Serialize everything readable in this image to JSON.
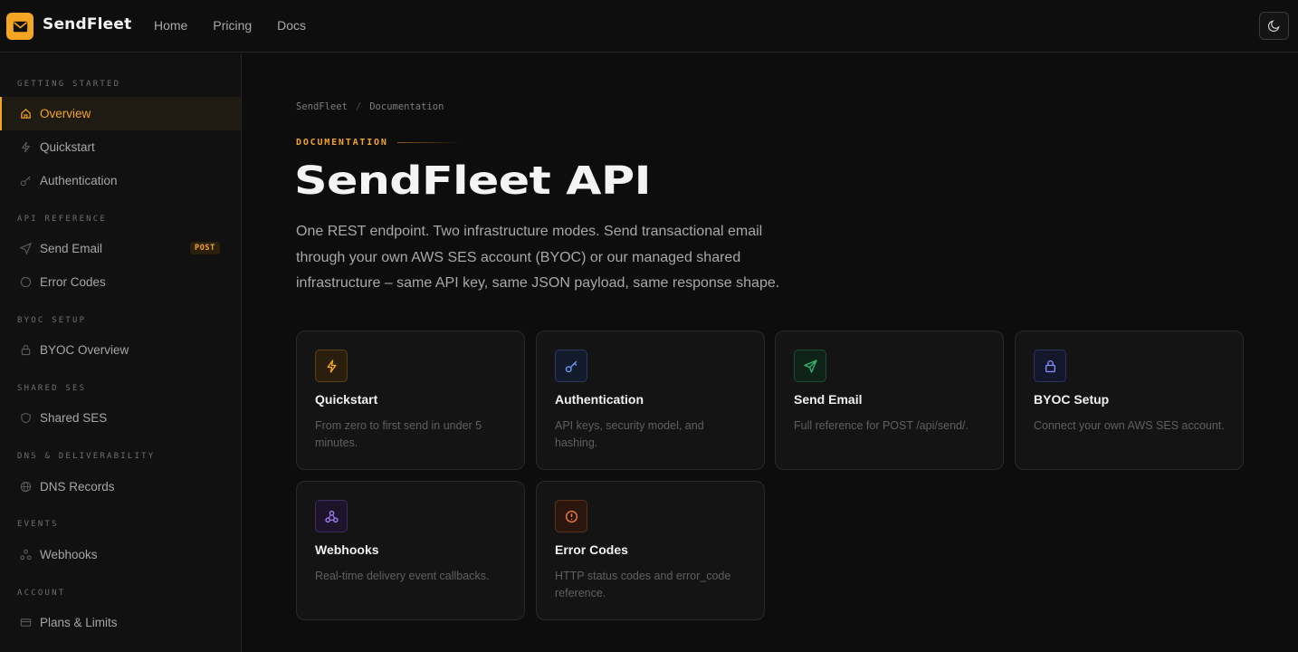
{
  "brand": {
    "name": "SendFleet"
  },
  "topnav": [
    {
      "label": "Home"
    },
    {
      "label": "Pricing"
    },
    {
      "label": "Docs"
    }
  ],
  "colors": {
    "accent": "#f5a524",
    "background": "#0d0d0d",
    "sidebar": "#111111"
  },
  "sidebar": {
    "sections": [
      {
        "title": "GETTING STARTED"
      },
      {
        "title": "API REFERENCE"
      },
      {
        "title": "BYOC SETUP"
      },
      {
        "title": "SHARED SES"
      },
      {
        "title": "DNS & DELIVERABILITY"
      },
      {
        "title": "EVENTS"
      },
      {
        "title": "ACCOUNT"
      }
    ],
    "items": [
      {
        "label": "Overview",
        "icon": "home-icon",
        "active": true
      },
      {
        "label": "Quickstart",
        "icon": "bolt-icon"
      },
      {
        "label": "Authentication",
        "icon": "key-icon"
      },
      {
        "label": "Send Email",
        "icon": "send-icon",
        "badge": "POST"
      },
      {
        "label": "Error Codes",
        "icon": "alert-circle-icon"
      },
      {
        "label": "BYOC Overview",
        "icon": "lock-icon"
      },
      {
        "label": "Shared SES",
        "icon": "shield-icon"
      },
      {
        "label": "DNS Records",
        "icon": "globe-icon"
      },
      {
        "label": "Webhooks",
        "icon": "webhook-icon"
      },
      {
        "label": "Plans & Limits",
        "icon": "card-icon"
      }
    ]
  },
  "breadcrumb": {
    "root": "SendFleet",
    "separator": "/",
    "current": "Documentation"
  },
  "eyebrow": "DOCUMENTATION",
  "title": "SendFleet API",
  "lede": "One REST endpoint. Two infrastructure modes. Send transactional email through your own AWS SES account (BYOC) or our managed shared infrastructure – same API key, same JSON payload, same response shape.",
  "cards": [
    {
      "title": "Quickstart",
      "desc": "From zero to first send in under 5 minutes.",
      "icon": "bolt-icon",
      "color": "#f5a524"
    },
    {
      "title": "Authentication",
      "desc": "API keys, security model, and hashing.",
      "icon": "key-icon",
      "color": "#5b8def"
    },
    {
      "title": "Send Email",
      "desc": "Full reference for POST /api/send/.",
      "icon": "send-icon",
      "color": "#2fb36b"
    },
    {
      "title": "BYOC Setup",
      "desc": "Connect your own AWS SES account.",
      "icon": "lock-icon",
      "color": "#6b7cf5"
    },
    {
      "title": "Webhooks",
      "desc": "Real-time delivery event callbacks.",
      "icon": "webhook-icon",
      "color": "#9b6bf5"
    },
    {
      "title": "Error Codes",
      "desc": "HTTP status codes and error_code reference.",
      "icon": "alert-circle-icon",
      "color": "#f07a3a"
    }
  ]
}
